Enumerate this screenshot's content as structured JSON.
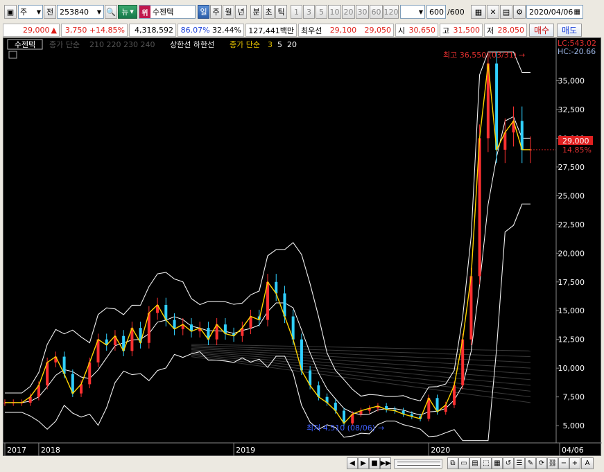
{
  "toolbar": {
    "type_label": "주",
    "jeon_label": "전",
    "stock_code": "253840",
    "news_label": "뉴",
    "warn_badge": "위",
    "stock_name": "수젠텍",
    "period_buttons": [
      "일",
      "주",
      "월",
      "년",
      "분",
      "초",
      "틱"
    ],
    "active_period": "일",
    "interval_buttons": [
      "1",
      "3",
      "5",
      "10",
      "20",
      "30",
      "60",
      "120"
    ],
    "count": "600",
    "count_total": "/600",
    "date": "2020/04/06"
  },
  "quote": {
    "price": "29,000",
    "change": "3,750",
    "change_pct": "+14.85%",
    "volume": "4,318,592",
    "ratio1": "86.07%",
    "ratio2": "32.44%",
    "amount": "127,441백만",
    "best_ask_label": "최우선",
    "best_ask": "29,100",
    "best_bid": "29,050",
    "open_label": "시",
    "open": "30,650",
    "high_label": "고",
    "high": "31,500",
    "low_label": "저",
    "low": "28,050",
    "buy_label": "매수",
    "sell_label": "매도"
  },
  "legend": {
    "stock_tag": "수젠텍",
    "ma_label": "종가 단순",
    "ma_periods": "210  220  230  240",
    "upper_lower": "상한선  하한선",
    "ma2_label": "종가 단순",
    "ma2_periods_a": "3",
    "ma2_periods_b": "5",
    "ma2_periods_c": "20"
  },
  "annotations": {
    "high_text": "최고 36,550 (03/31)",
    "low_text": "최저 4,510 (08/06)",
    "lc_text": "LC:543.02",
    "hc_text": "HC:-20.66",
    "current_price_tag": "29,000",
    "current_pct_tag": "14.85%"
  },
  "chart_data": {
    "type": "line",
    "title": "",
    "ylim": [
      3500,
      37500
    ],
    "y_ticks": [
      5000,
      7500,
      10000,
      12500,
      15000,
      17500,
      20000,
      22500,
      25000,
      27500,
      30000,
      32500,
      35000
    ],
    "y_tick_labels": [
      "5,000",
      "7,500",
      "10,000",
      "12,500",
      "15,000",
      "17,500",
      "20,000",
      "22,500",
      "25,000",
      "27,500",
      "30,000",
      "32,500",
      "35,000"
    ],
    "x_labels": [
      {
        "label": "2017",
        "index": 0
      },
      {
        "label": "2018",
        "index": 4
      },
      {
        "label": "2019",
        "index": 27
      },
      {
        "label": "2020",
        "index": 50
      },
      {
        "label": "04/06",
        "index": 63
      }
    ],
    "n_points": 63,
    "series": [
      {
        "name": "종가",
        "color": "#ffd400",
        "values": [
          7000,
          7000,
          7000,
          7500,
          8500,
          10500,
          11000,
          9500,
          7800,
          8600,
          10500,
          12500,
          12000,
          12800,
          11500,
          13500,
          12200,
          14800,
          15500,
          14200,
          13400,
          13800,
          13200,
          13500,
          12500,
          13800,
          13000,
          12800,
          13500,
          14500,
          14200,
          17500,
          16500,
          14500,
          12500,
          9800,
          8500,
          7500,
          7000,
          6300,
          5200,
          6000,
          6300,
          6500,
          6700,
          6400,
          6300,
          6000,
          5800,
          5600,
          7400,
          6200,
          6800,
          8500,
          12500,
          18000,
          30000,
          36500,
          29000,
          30500,
          31500,
          29000,
          29000
        ]
      }
    ],
    "high_point": {
      "value": 36550,
      "date": "03/31"
    },
    "low_point": {
      "value": 4510,
      "date": "08/06"
    }
  },
  "bottom": {
    "nav_buttons": [
      "◀",
      "▶",
      "■",
      "▶▶"
    ],
    "zoom_minus": "−",
    "zoom_plus": "+",
    "font_button": "A"
  }
}
